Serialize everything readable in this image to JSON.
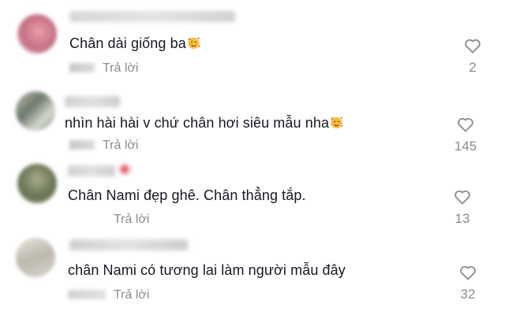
{
  "comments": [
    {
      "text": "Chân dài giống ba",
      "emoji": "smiling-face-with-hearts",
      "reply_label": "Trả lời",
      "likes": "2",
      "avatar_color": "#d8a0a8"
    },
    {
      "text": "nhìn hài hài v chứ chân hơi siêu mẫu nha",
      "emoji": "smiling-face-with-hearts",
      "reply_label": "Trả lời",
      "likes": "145",
      "avatar_color": "#9aa69a"
    },
    {
      "text": "Chân Nami đẹp ghê. Chân thẳng tắp.",
      "reply_label": "Trả lời",
      "likes": "13",
      "avatar_color": "#7a8468"
    },
    {
      "text": "chân Nami có tương lai làm người mẫu đây",
      "reply_label": "Trả lời",
      "likes": "32",
      "avatar_color": "#c8c4bc"
    }
  ],
  "colors": {
    "text": "#161823",
    "muted": "#8a8b91",
    "background": "#ffffff"
  }
}
